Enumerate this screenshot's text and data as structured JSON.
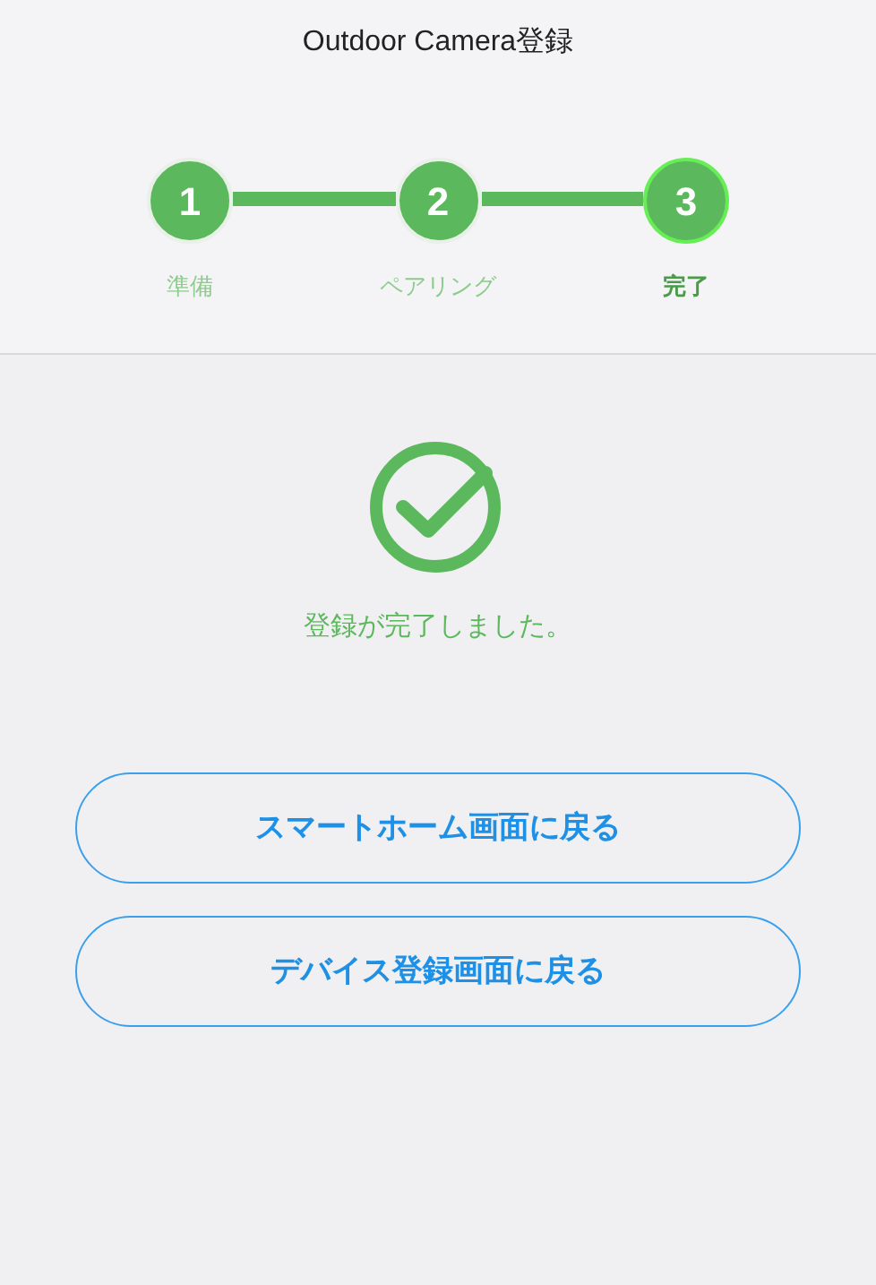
{
  "header": {
    "title": "Outdoor Camera登録"
  },
  "steps": [
    {
      "number": "1",
      "label": "準備",
      "selected": false
    },
    {
      "number": "2",
      "label": "ペアリング",
      "selected": false
    },
    {
      "number": "3",
      "label": "完了",
      "selected": true
    }
  ],
  "result": {
    "message": "登録が完了しました。"
  },
  "buttons": [
    "スマートホーム画面に戻る",
    "デバイス登録画面に戻る"
  ]
}
